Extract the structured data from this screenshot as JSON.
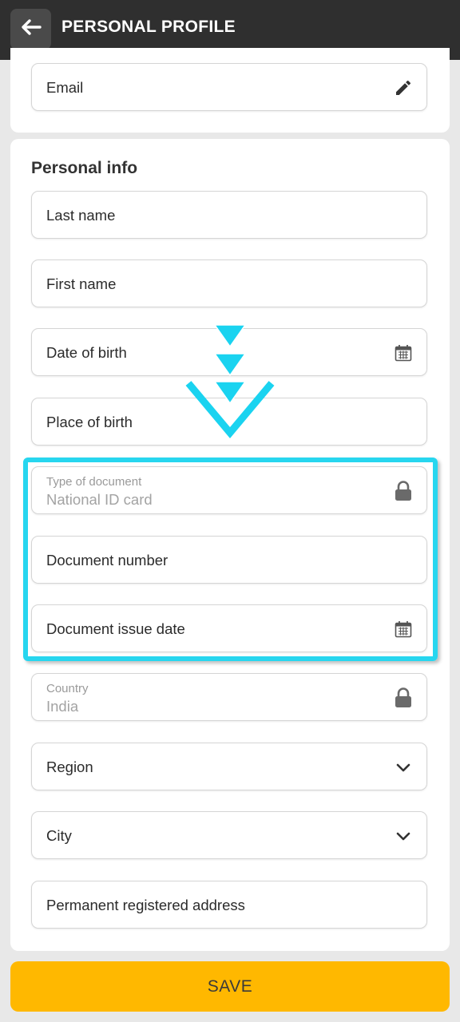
{
  "header": {
    "title": "PERSONAL PROFILE",
    "back_icon": "arrow-left-icon"
  },
  "contact": {
    "email_label": "Email"
  },
  "personal_info": {
    "title": "Personal info",
    "last_name": "Last name",
    "first_name": "First name",
    "date_of_birth": "Date of birth",
    "place_of_birth": "Place of birth",
    "document_type": {
      "label": "Type of document",
      "value": "National ID card"
    },
    "document_number": "Document number",
    "document_issue_date": "Document issue date",
    "country": {
      "label": "Country",
      "value": "India"
    },
    "region": "Region",
    "city": "City",
    "address": "Permanent registered address"
  },
  "actions": {
    "save_label": "SAVE"
  },
  "colors": {
    "accent": "#ffb800",
    "highlight": "#27d6ef",
    "header": "#2f2f2f"
  }
}
